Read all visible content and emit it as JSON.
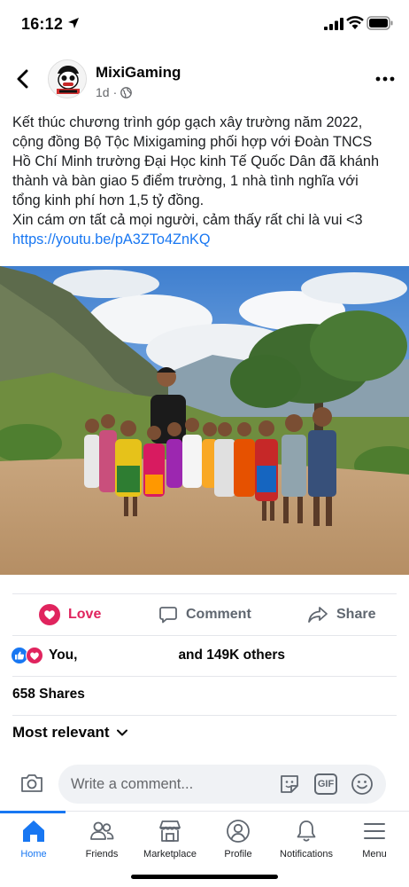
{
  "status_bar": {
    "time": "16:12"
  },
  "post": {
    "page_name": "MixiGaming",
    "time_ago": "1d",
    "privacy_separator": "·",
    "text_lines": [
      "Kết thúc chương trình góp gạch xây trường năm 2022,",
      "cộng đồng Bộ Tộc Mixigaming phối hợp với Đoàn TNCS",
      "Hồ Chí Minh trường Đại Học kinh Tế Quốc Dân đã khánh",
      "thành và bàn giao 5 điểm trường, 1 nhà tình nghĩa với",
      "tổng kinh phí hơn 1,5 tỷ đồng.",
      "Xin cám ơn tất cả mọi người, cảm thấy rất chi là vui <3"
    ],
    "link": "https://youtu.be/pA3ZTo4ZnKQ"
  },
  "actions": {
    "love": "Love",
    "comment": "Comment",
    "share": "Share"
  },
  "reactions": {
    "you": "You, ",
    "others": "and 149K others"
  },
  "shares": "658 Shares",
  "sort": "Most relevant",
  "comment_box": {
    "placeholder": "Write a comment..."
  },
  "gif_label": "GIF",
  "nav": [
    {
      "label": "Home"
    },
    {
      "label": "Friends"
    },
    {
      "label": "Marketplace"
    },
    {
      "label": "Profile"
    },
    {
      "label": "Notifications"
    },
    {
      "label": "Menu"
    }
  ],
  "colors": {
    "accent": "#1877f2",
    "love": "#e0245e",
    "text": "#050505",
    "muted": "#65676b"
  },
  "icons": [
    "back-arrow-icon",
    "globe-icon",
    "more-icon",
    "heart-icon",
    "comment-icon",
    "share-icon",
    "like-icon",
    "camera-icon",
    "sticker-icon",
    "emoji-icon",
    "home-icon",
    "friends-icon",
    "marketplace-icon",
    "profile-icon",
    "bell-icon",
    "menu-icon"
  ]
}
